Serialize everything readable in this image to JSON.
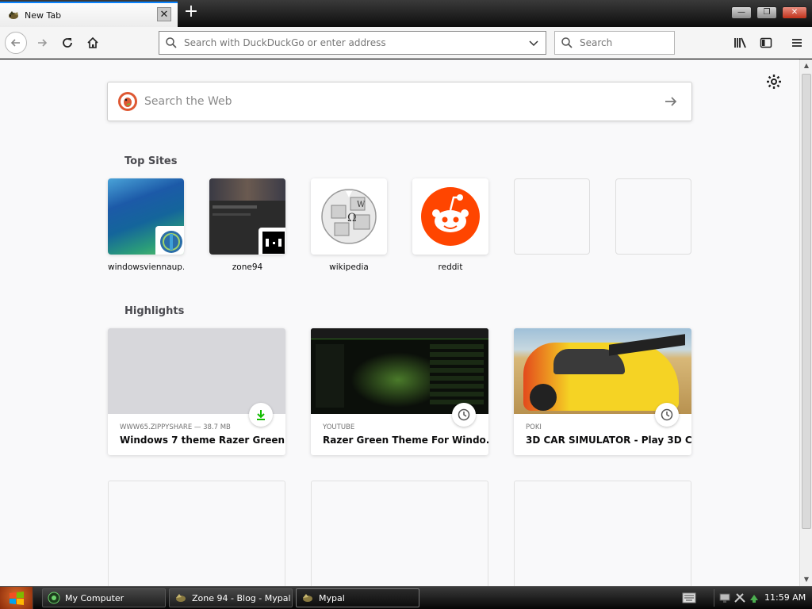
{
  "window": {
    "tab_title": "New Tab",
    "tab_close_glyph": "✕",
    "new_tab_glyph": "+",
    "minimize_glyph": "—",
    "restore_glyph": "❐",
    "close_glyph": "✕"
  },
  "toolbar": {
    "url_placeholder": "Search with DuckDuckGo or enter address",
    "search_placeholder": "Search"
  },
  "content": {
    "web_search_placeholder": "Search the Web",
    "top_sites_title": "Top Sites",
    "highlights_title": "Highlights",
    "top_sites": [
      {
        "label": "windowsviennaup..."
      },
      {
        "label": "zone94"
      },
      {
        "label": "wikipedia"
      },
      {
        "label": "reddit"
      }
    ],
    "highlights": [
      {
        "source": "WWW65.ZIPPYSHARE — 38.7 MB",
        "title": "Windows 7 theme Razer Green ...",
        "badge": "download-icon"
      },
      {
        "source": "YOUTUBE",
        "title": "Razer Green Theme For Windo...",
        "badge": "clock-icon"
      },
      {
        "source": "POKI",
        "title": "3D CAR SIMULATOR - Play 3D C...",
        "badge": "clock-icon"
      }
    ]
  },
  "taskbar": {
    "items": [
      {
        "label": "My Computer"
      },
      {
        "label": "Zone 94 - Blog - Mypal"
      },
      {
        "label": "Mypal"
      }
    ],
    "clock": "11:59 AM"
  },
  "colors": {
    "accent": "#0a84ff",
    "reddit": "#ff4500",
    "download_green": "#12bc00"
  }
}
